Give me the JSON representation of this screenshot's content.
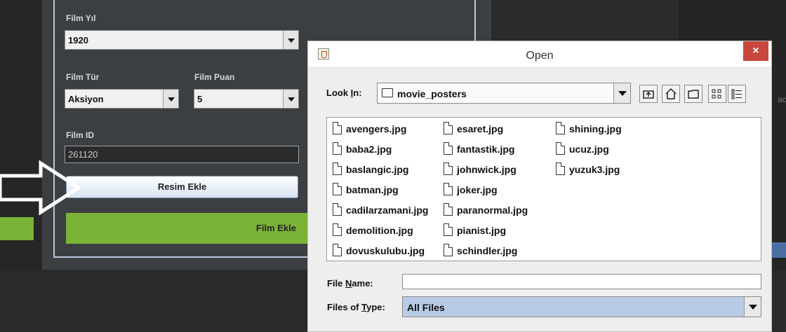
{
  "form": {
    "year_label": "Film Yıl",
    "year_value": "1920",
    "genre_label": "Film Tür",
    "genre_value": "Aksiyon",
    "score_label": "Film Puan",
    "score_value": "5",
    "id_label": "Film ID",
    "id_value": "261120",
    "add_image_label": "Resim Ekle",
    "add_film_label": "Film Ekle"
  },
  "background": {
    "partial_text": "ac"
  },
  "dialog": {
    "title": "Open",
    "close_symbol": "×",
    "look_in_label_pre": "Look ",
    "look_in_label_mnemonic": "I",
    "look_in_label_post": "n:",
    "look_in_value": "movie_posters",
    "files": [
      "avengers.jpg",
      "baba2.jpg",
      "baslangic.jpg",
      "batman.jpg",
      "cadilarzamani.jpg",
      "demolition.jpg",
      "dovuskulubu.jpg",
      "esaret.jpg",
      "fantastik.jpg",
      "johnwick.jpg",
      "joker.jpg",
      "paranormal.jpg",
      "pianist.jpg",
      "schindler.jpg",
      "shining.jpg",
      "ucuz.jpg",
      "yuzuk3.jpg"
    ],
    "file_name_label_pre": "File ",
    "file_name_label_mnemonic": "N",
    "file_name_label_post": "ame:",
    "file_name_value": "",
    "files_of_type_label_pre": "Files of ",
    "files_of_type_label_mnemonic": "T",
    "files_of_type_label_post": "ype:",
    "files_of_type_value": "All Files"
  },
  "icons": {
    "title": "java-app-icon",
    "folder": "folder-icon",
    "up": "up-one-level-icon",
    "home": "home-icon",
    "new_folder": "new-folder-icon",
    "list_view": "list-view-icon",
    "details_view": "details-view-icon",
    "file": "document-icon"
  },
  "colors": {
    "green_button": "#7ab335",
    "close_button": "#c7463d",
    "selected_type": "#b8cbe6"
  }
}
